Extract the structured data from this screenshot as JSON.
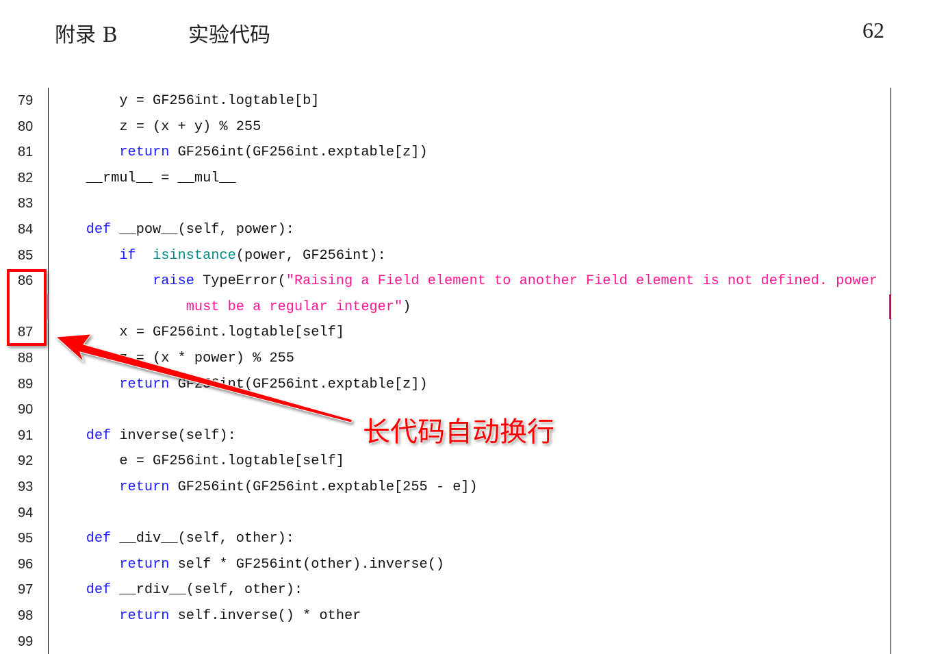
{
  "header": {
    "chapter": "附录 B",
    "title": "实验代码",
    "page_number": "62"
  },
  "colors": {
    "keyword": "#1a1aff",
    "builtin": "#008b8b",
    "string": "#ff1493",
    "annotation": "#ff0000"
  },
  "annotation": {
    "callout": "长代码自动换行"
  },
  "lines": [
    {
      "num": "79",
      "segs": [
        [
          "        y = GF256int.logtable[b]",
          ""
        ]
      ]
    },
    {
      "num": "80",
      "segs": [
        [
          "        z = (x + y) % 255",
          ""
        ]
      ]
    },
    {
      "num": "81",
      "segs": [
        [
          "        ",
          ""
        ],
        [
          "return",
          "kw"
        ],
        [
          " GF256int(GF256int.exptable[z])",
          ""
        ]
      ]
    },
    {
      "num": "82",
      "segs": [
        [
          "    __rmul__ = __mul__",
          ""
        ]
      ]
    },
    {
      "num": "83",
      "segs": []
    },
    {
      "num": "84",
      "segs": [
        [
          "    ",
          ""
        ],
        [
          "def",
          "kw"
        ],
        [
          " __pow__(self, power):",
          ""
        ]
      ]
    },
    {
      "num": "85",
      "segs": [
        [
          "        ",
          ""
        ],
        [
          "if",
          "kw"
        ],
        [
          "  ",
          ""
        ],
        [
          "isinstance",
          "bi"
        ],
        [
          "(power, GF256int):",
          ""
        ]
      ]
    },
    {
      "num": "86",
      "segs": [
        [
          "            ",
          ""
        ],
        [
          "raise",
          "kw"
        ],
        [
          " TypeError(",
          ""
        ],
        [
          "\"Raising a Field element to another Field element is not defined. power",
          "st"
        ]
      ]
    },
    {
      "num": "",
      "segs": [
        [
          "                ",
          ""
        ],
        [
          "must be a regular integer\"",
          "st"
        ],
        [
          ")",
          ""
        ]
      ]
    },
    {
      "num": "87",
      "segs": [
        [
          "        x = GF256int.logtable[self]",
          ""
        ]
      ]
    },
    {
      "num": "88",
      "segs": [
        [
          "        z = (x * power) % 255",
          ""
        ]
      ]
    },
    {
      "num": "89",
      "segs": [
        [
          "        ",
          ""
        ],
        [
          "return",
          "kw"
        ],
        [
          " GF256int(GF256int.exptable[z])",
          ""
        ]
      ]
    },
    {
      "num": "90",
      "segs": []
    },
    {
      "num": "91",
      "segs": [
        [
          "    ",
          ""
        ],
        [
          "def",
          "kw"
        ],
        [
          " inverse(self):",
          ""
        ]
      ]
    },
    {
      "num": "92",
      "segs": [
        [
          "        e = GF256int.logtable[self]",
          ""
        ]
      ]
    },
    {
      "num": "93",
      "segs": [
        [
          "        ",
          ""
        ],
        [
          "return",
          "kw"
        ],
        [
          " GF256int(GF256int.exptable[255 - e])",
          ""
        ]
      ]
    },
    {
      "num": "94",
      "segs": []
    },
    {
      "num": "95",
      "segs": [
        [
          "    ",
          ""
        ],
        [
          "def",
          "kw"
        ],
        [
          " __div__(self, other):",
          ""
        ]
      ]
    },
    {
      "num": "96",
      "segs": [
        [
          "        ",
          ""
        ],
        [
          "return",
          "kw"
        ],
        [
          " self * GF256int(other).inverse()",
          ""
        ]
      ]
    },
    {
      "num": "97",
      "segs": [
        [
          "    ",
          ""
        ],
        [
          "def",
          "kw"
        ],
        [
          " __rdiv__(self, other):",
          ""
        ]
      ]
    },
    {
      "num": "98",
      "segs": [
        [
          "        ",
          ""
        ],
        [
          "return",
          "kw"
        ],
        [
          " self.inverse() * other",
          ""
        ]
      ]
    },
    {
      "num": "99",
      "segs": []
    }
  ]
}
